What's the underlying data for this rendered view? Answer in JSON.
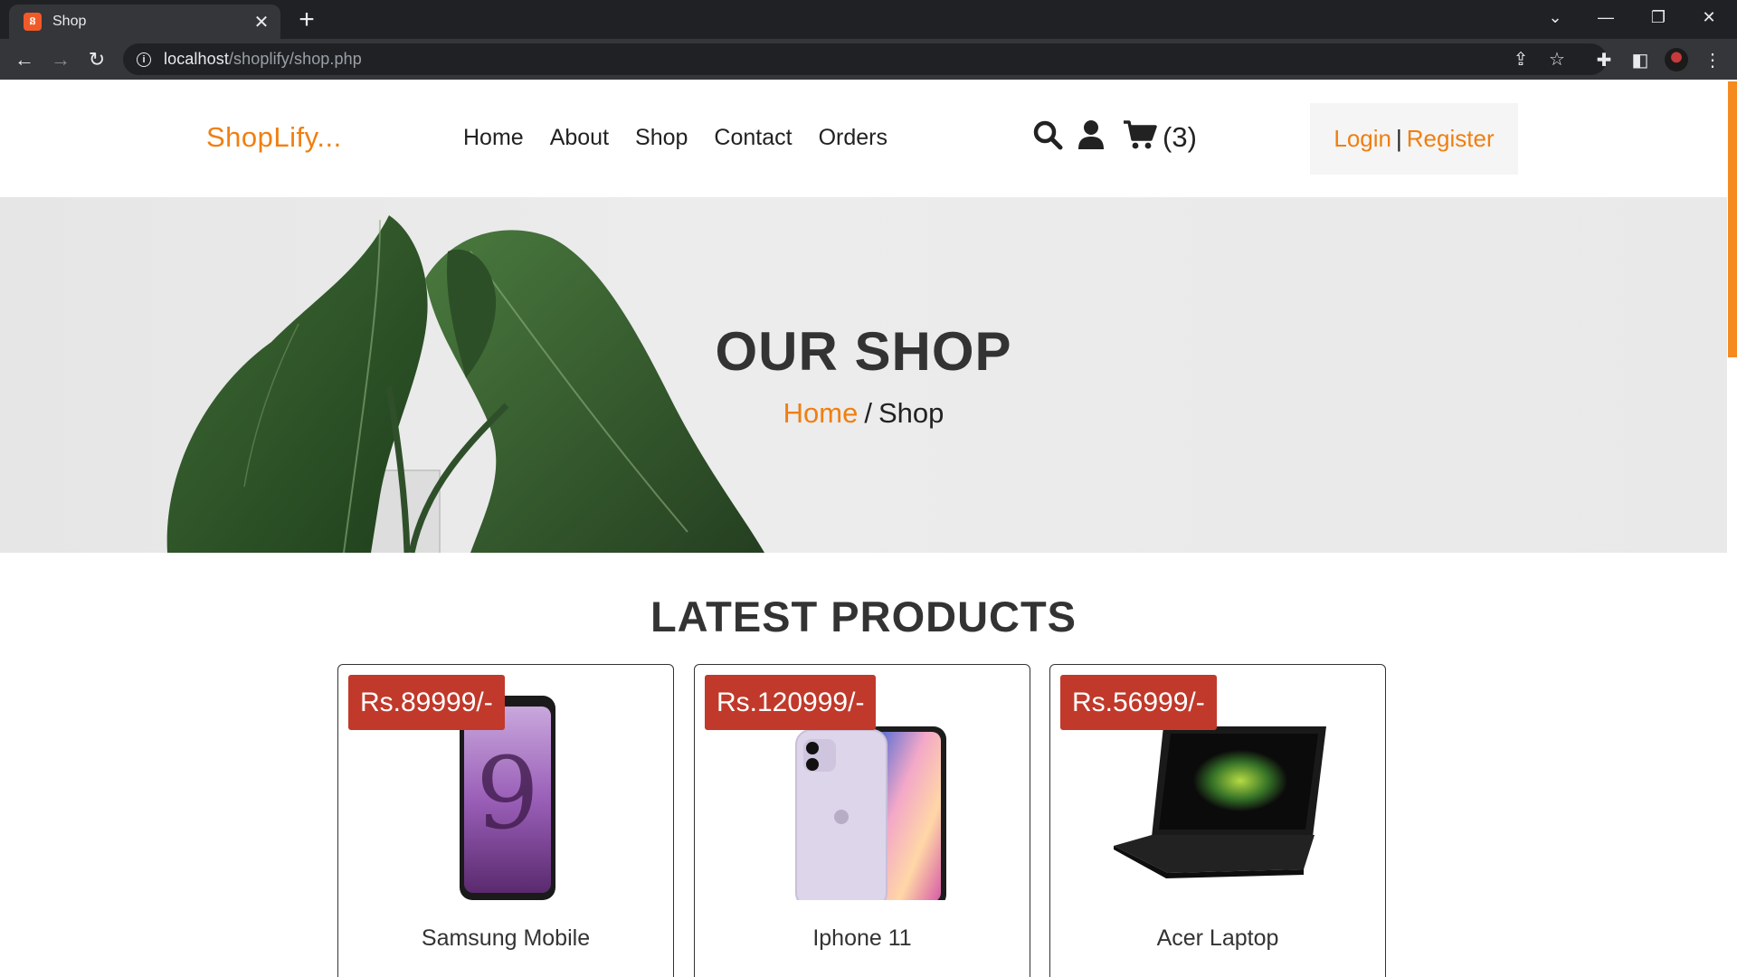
{
  "browser": {
    "tab_title": "Shop",
    "url_host": "localhost",
    "url_path": "/shoplify/shop.php"
  },
  "header": {
    "logo": "ShopLify...",
    "nav": [
      "Home",
      "About",
      "Shop",
      "Contact",
      "Orders"
    ],
    "cart_count": "(3)",
    "login": "Login",
    "separator": "|",
    "register": "Register"
  },
  "hero": {
    "title": "OUR SHOP",
    "crumb_home": "Home",
    "crumb_sep": "/",
    "crumb_current": "Shop"
  },
  "section_title": "LATEST PRODUCTS",
  "products": [
    {
      "price": "Rs.89999/-",
      "name": "Samsung Mobile"
    },
    {
      "price": "Rs.120999/-",
      "name": "Iphone 11"
    },
    {
      "price": "Rs.56999/-",
      "name": "Acer Laptop"
    }
  ],
  "colors": {
    "accent": "#f07f10",
    "price_badge": "#c0392b",
    "text_dark": "#333333"
  }
}
